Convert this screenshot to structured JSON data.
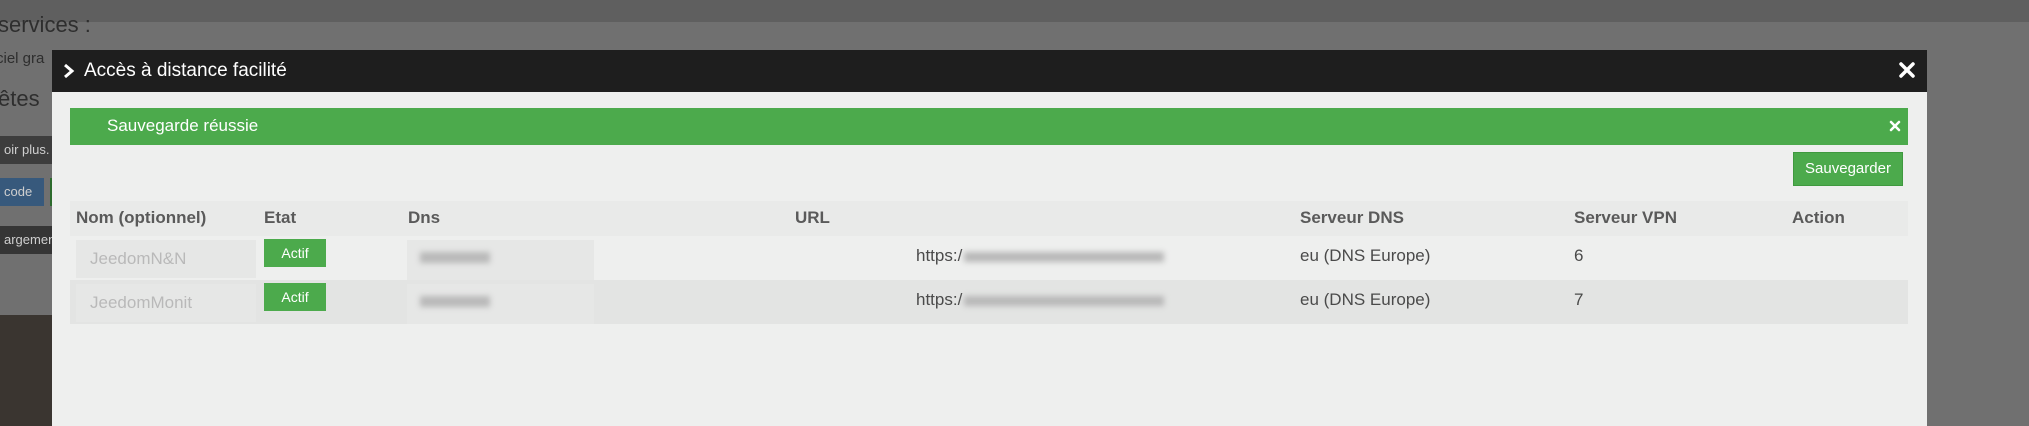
{
  "background": {
    "heading": "services :",
    "text_line": "ciel gra",
    "heading2": "êtes",
    "button1": "oir plus.",
    "button2": "code",
    "button3": "argemen"
  },
  "modal": {
    "title": "Accès à distance facilité",
    "alert": "Sauvegarde réussie",
    "save_label": "Sauvegarder",
    "columns": {
      "name": "Nom (optionnel)",
      "state": "Etat",
      "dns": "Dns",
      "url": "URL",
      "dns_server": "Serveur DNS",
      "vpn_server": "Serveur VPN",
      "action": "Action"
    },
    "rows": [
      {
        "name": "JeedomN&N",
        "state": "Actif",
        "url_prefix": "https:/",
        "dns_server": "eu (DNS Europe)",
        "vpn_server": "6"
      },
      {
        "name": "JeedomMonit",
        "state": "Actif",
        "url_prefix": "https:/",
        "dns_server": "eu (DNS Europe)",
        "vpn_server": "7"
      }
    ]
  },
  "colors": {
    "success": "#4caa4c",
    "header": "#1e1e1e",
    "modal_bg": "#eeefee"
  },
  "icons": {
    "chevron": "chevron-right-icon",
    "close": "close-icon",
    "alert_close": "close-icon"
  }
}
